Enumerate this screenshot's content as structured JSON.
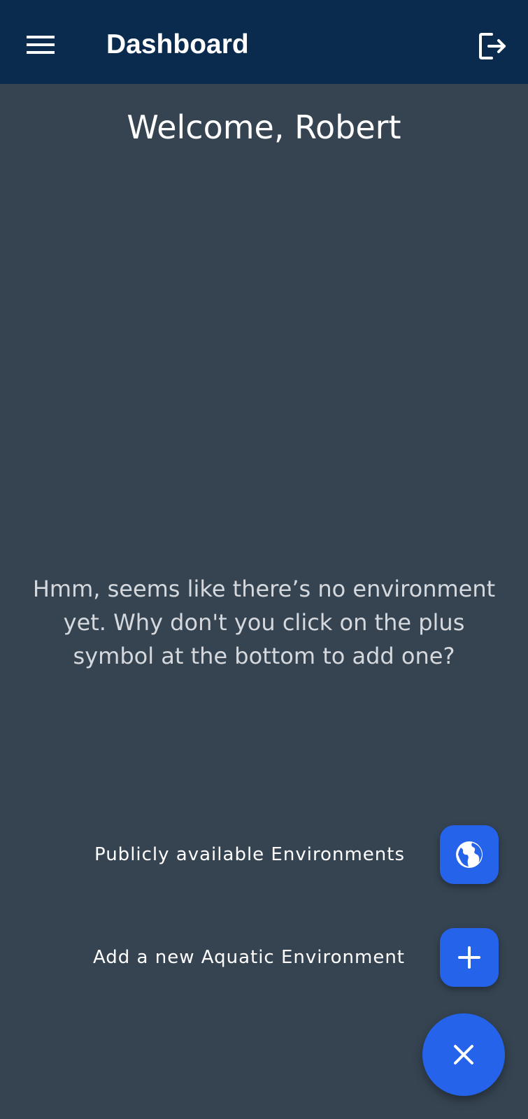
{
  "appbar": {
    "title": "Dashboard",
    "menu_icon": "hamburger-menu-icon",
    "logout_icon": "logout-icon",
    "background": "#0a2b4d"
  },
  "main": {
    "welcome": "Welcome, Robert",
    "empty_message": "Hmm, seems like there’s no environment yet. Why don't you click on the plus symbol at the bottom to add one?",
    "background": "#364452"
  },
  "speed_dial": {
    "accent": "#2563eb",
    "actions": [
      {
        "label": "Publicly available Environments",
        "icon": "globe-icon"
      },
      {
        "label": "Add a new Aquatic Environment",
        "icon": "plus-icon"
      }
    ],
    "main_icon": "close-icon"
  }
}
